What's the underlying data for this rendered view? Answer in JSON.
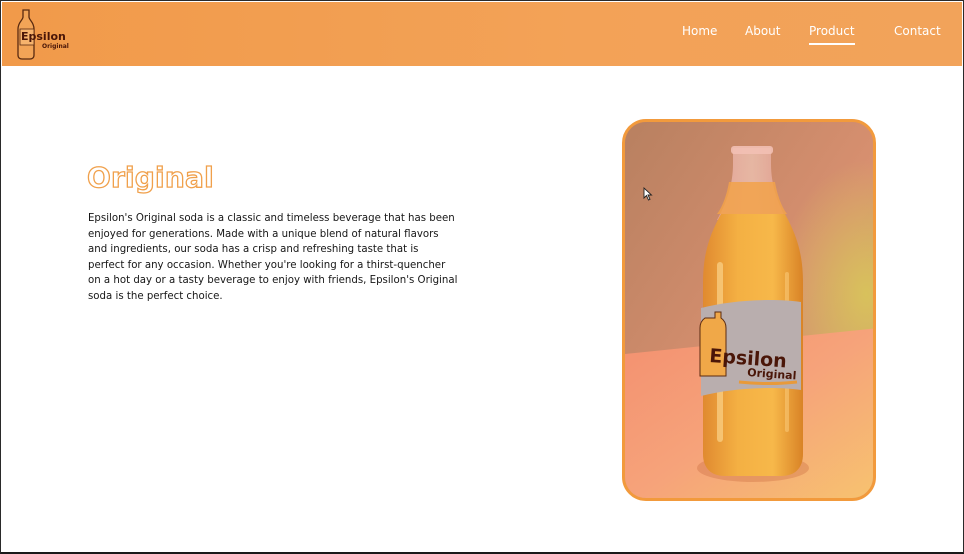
{
  "header": {
    "logo": {
      "brand": "Epsilon",
      "subtitle": "Original",
      "icon": "bottle-logo-icon"
    },
    "nav": [
      {
        "label": "Home",
        "active": false
      },
      {
        "label": "About",
        "active": false
      },
      {
        "label": "Product",
        "active": true
      },
      {
        "label": "Contact",
        "active": false
      }
    ]
  },
  "main": {
    "title": "Original",
    "description": "Epsilon's Original soda is a classic and timeless beverage that has been enjoyed for generations. Made with a unique blend of natural flavors and ingredients, our soda has a crisp and refreshing taste that is perfect for any occasion. Whether you're looking for a thirst-quencher on a hot day or a tasty beverage to enjoy with friends, Epsilon's Original soda is the perfect choice.",
    "product_image": {
      "label_brand": "Epsilon",
      "label_subtitle": "Original"
    }
  },
  "colors": {
    "accent": "#f29a3c",
    "header_bg": "#f19f52",
    "text": "#161616"
  }
}
